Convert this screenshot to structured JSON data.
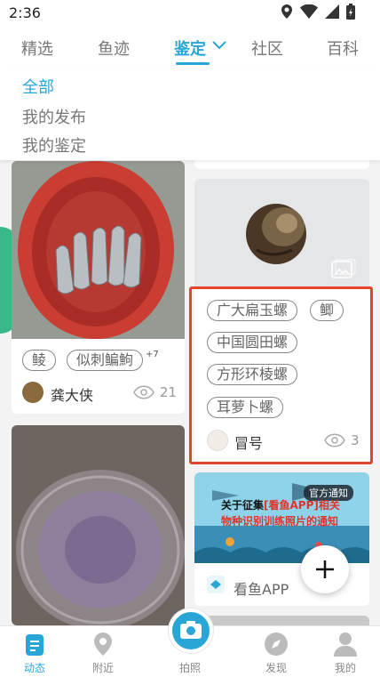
{
  "status_bar": {
    "time": "2:36"
  },
  "top_tabs": [
    {
      "label": "精选"
    },
    {
      "label": "鱼迹"
    },
    {
      "label": "鉴定"
    },
    {
      "label": "社区"
    },
    {
      "label": "百科"
    }
  ],
  "filter_menu": {
    "items": [
      {
        "label": "全部"
      },
      {
        "label": "我的发布"
      },
      {
        "label": "我的鉴定"
      }
    ]
  },
  "feed": {
    "left_card_1": {
      "tags": [
        "鲮",
        "似刺鳊鮈"
      ],
      "more_count": "+7",
      "author": "龚大侠",
      "views": "21"
    },
    "right_card_1": {
      "tags": [
        "广大扁玉螺",
        "鲫",
        "中国圆田螺",
        "方形环棱螺",
        "耳萝卜螺"
      ],
      "author": "冒号",
      "views": "3"
    },
    "right_card_2": {
      "badge": "官方通知",
      "headline_prefix": "关于征集",
      "headline_highlight": "[看鱼APP]相关",
      "headline_line2": "物种识别训练照片的通知",
      "author": "看鱼APP"
    }
  },
  "bottom_nav": [
    {
      "label": "动态"
    },
    {
      "label": "附近"
    },
    {
      "label": "拍照"
    },
    {
      "label": "发现"
    },
    {
      "label": "我的"
    }
  ],
  "colors": {
    "accent": "#2aa6d6",
    "highlight_border": "#e2452f"
  }
}
